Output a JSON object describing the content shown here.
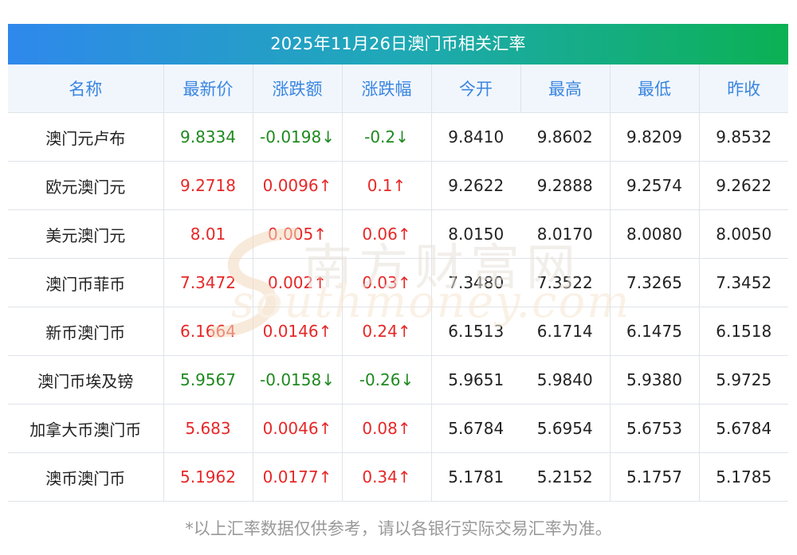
{
  "title": "2025年11月26日澳门币相关汇率",
  "headers": [
    "名称",
    "最新价",
    "涨跌额",
    "涨跌幅",
    "今开",
    "最高",
    "最低",
    "昨收"
  ],
  "rows": [
    {
      "name": "澳门元卢布",
      "latest": "9.8334",
      "change": "-0.0198↓",
      "pct": "-0.2↓",
      "open": "9.8410",
      "high": "9.8602",
      "low": "9.8209",
      "prev": "9.8532",
      "dir": "down"
    },
    {
      "name": "欧元澳门元",
      "latest": "9.2718",
      "change": "0.0096↑",
      "pct": "0.1↑",
      "open": "9.2622",
      "high": "9.2888",
      "low": "9.2574",
      "prev": "9.2622",
      "dir": "up"
    },
    {
      "name": "美元澳门元",
      "latest": "8.01",
      "change": "0.005↑",
      "pct": "0.06↑",
      "open": "8.0150",
      "high": "8.0170",
      "low": "8.0080",
      "prev": "8.0050",
      "dir": "up"
    },
    {
      "name": "澳门币菲币",
      "latest": "7.3472",
      "change": "0.002↑",
      "pct": "0.03↑",
      "open": "7.3480",
      "high": "7.3522",
      "low": "7.3265",
      "prev": "7.3452",
      "dir": "up"
    },
    {
      "name": "新币澳门币",
      "latest": "6.1664",
      "change": "0.0146↑",
      "pct": "0.24↑",
      "open": "6.1513",
      "high": "6.1714",
      "low": "6.1475",
      "prev": "6.1518",
      "dir": "up"
    },
    {
      "name": "澳门币埃及镑",
      "latest": "5.9567",
      "change": "-0.0158↓",
      "pct": "-0.26↓",
      "open": "5.9651",
      "high": "5.9840",
      "low": "5.9380",
      "prev": "5.9725",
      "dir": "down"
    },
    {
      "name": "加拿大币澳门币",
      "latest": "5.683",
      "change": "0.0046↑",
      "pct": "0.08↑",
      "open": "5.6784",
      "high": "5.6954",
      "low": "5.6753",
      "prev": "5.6784",
      "dir": "up"
    },
    {
      "name": "澳币澳门币",
      "latest": "5.1962",
      "change": "0.0177↑",
      "pct": "0.34↑",
      "open": "5.1781",
      "high": "5.2152",
      "low": "5.1757",
      "prev": "5.1785",
      "dir": "up"
    }
  ],
  "watermark": {
    "cn": "南方财富网",
    "en": "southmoney.com"
  },
  "footnote": "*以上汇率数据仅供参考，请以各银行实际交易汇率为准。",
  "colors": {
    "up": "#e62828",
    "down": "#1e8a1e",
    "header_text": "#3a86e0"
  }
}
